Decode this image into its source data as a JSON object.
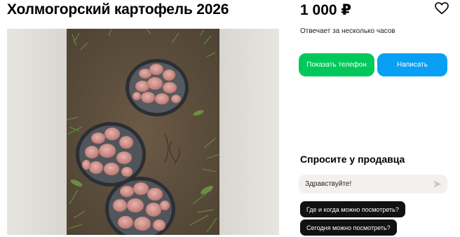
{
  "listing": {
    "title": "Холмогорский картофель 2026",
    "price": "1 000 ₽",
    "response_time": "Отвечает за несколько часов"
  },
  "actions": {
    "show_phone": "Показать телефон",
    "write": "Написать"
  },
  "chat": {
    "heading": "Спросите у продавца",
    "message_value": "Здравствуйте!",
    "suggestions": [
      "Где и когда можно посмотреть?",
      "Сегодня можно посмотреть?"
    ]
  },
  "icons": {
    "favorite": "heart-icon",
    "send": "send-icon"
  },
  "colors": {
    "phone_button": "#00c85a",
    "write_button": "#07a0f5",
    "chip_background": "#111111"
  }
}
